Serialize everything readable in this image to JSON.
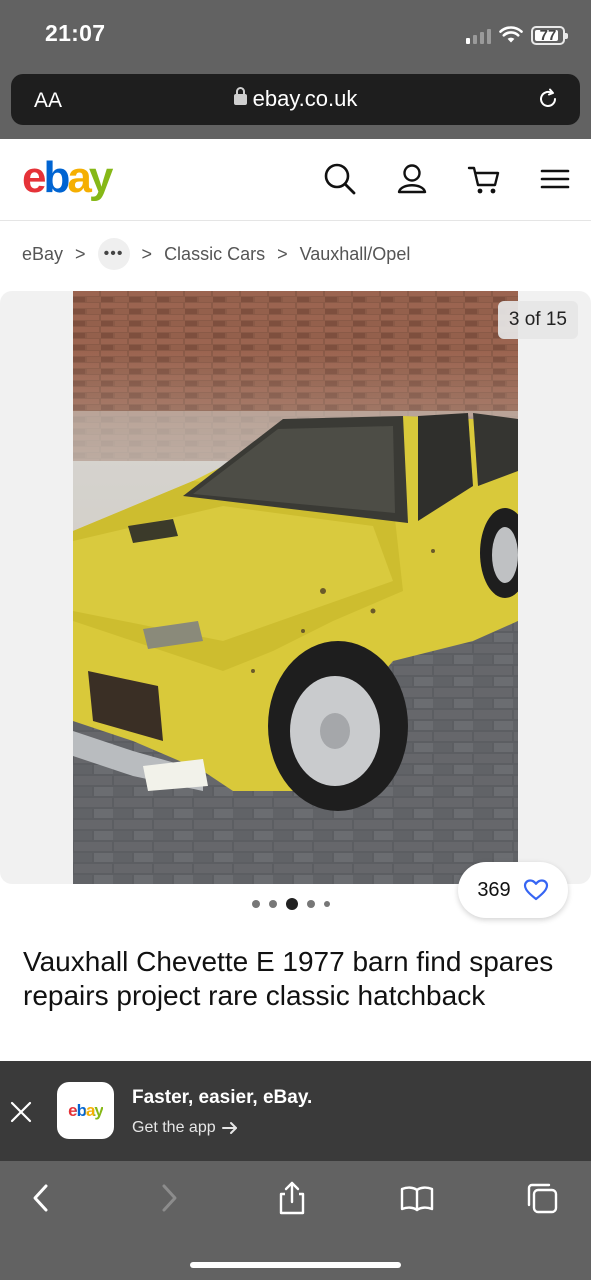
{
  "status_bar": {
    "time": "21:07",
    "battery": "77"
  },
  "browser": {
    "text_size_label": "AA",
    "domain": "ebay.co.uk"
  },
  "header": {
    "logo": {
      "e": "e",
      "b": "b",
      "a": "a",
      "y": "y"
    },
    "icons": [
      "search-icon",
      "account-icon",
      "cart-icon",
      "menu-icon"
    ]
  },
  "breadcrumb": {
    "items": [
      "eBay",
      "Classic Cars",
      "Vauxhall/Opel"
    ],
    "more": "•••",
    "separator": ">"
  },
  "gallery": {
    "counter": "3 of 15",
    "dots_total": 5,
    "dots_active_index": 2,
    "watch_count": "369"
  },
  "listing": {
    "title": "Vauxhall Chevette E 1977 barn find spares repairs project rare classic hatchback"
  },
  "app_banner": {
    "app_icon_text": "ebay",
    "title": "Faster, easier, eBay.",
    "subtitle": "Get the app"
  },
  "toolbar": {
    "icons": [
      "back-icon",
      "forward-icon",
      "share-icon",
      "bookmarks-icon",
      "tabs-icon"
    ]
  },
  "colors": {
    "ebay_red": "#e53238",
    "ebay_blue": "#0064d2",
    "ebay_yellow": "#f5af02",
    "ebay_green": "#86b817",
    "watch_heart": "#3665f3"
  }
}
